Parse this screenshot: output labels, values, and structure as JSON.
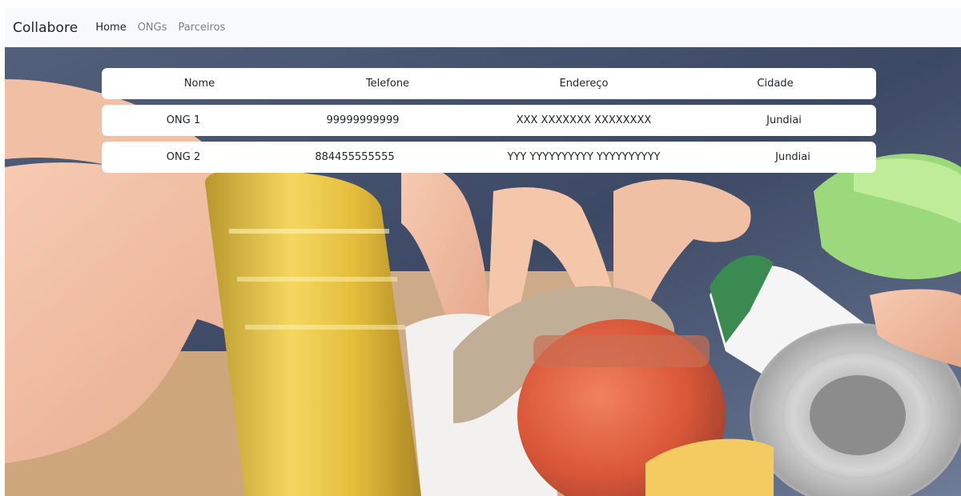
{
  "navbar": {
    "brand": "Collabore",
    "links": [
      {
        "label": "Home",
        "active": true
      },
      {
        "label": "ONGs",
        "active": false
      },
      {
        "label": "Parceiros",
        "active": false
      }
    ]
  },
  "table": {
    "headers": [
      "Nome",
      "Telefone",
      "Endereço",
      "Cidade"
    ],
    "rows": [
      [
        "ONG 1",
        "99999999999",
        "XXX XXXXXXX XXXXXXXX",
        "Jundiai"
      ],
      [
        "ONG 2",
        "884455555555",
        "YYY YYYYYYYYYY YYYYYYYYYY",
        "Jundiai"
      ]
    ]
  },
  "colors": {
    "navbar_bg": "#f8f9fa",
    "text": "#212529",
    "muted_link": "#808080",
    "card_bg": "#ffffff"
  }
}
